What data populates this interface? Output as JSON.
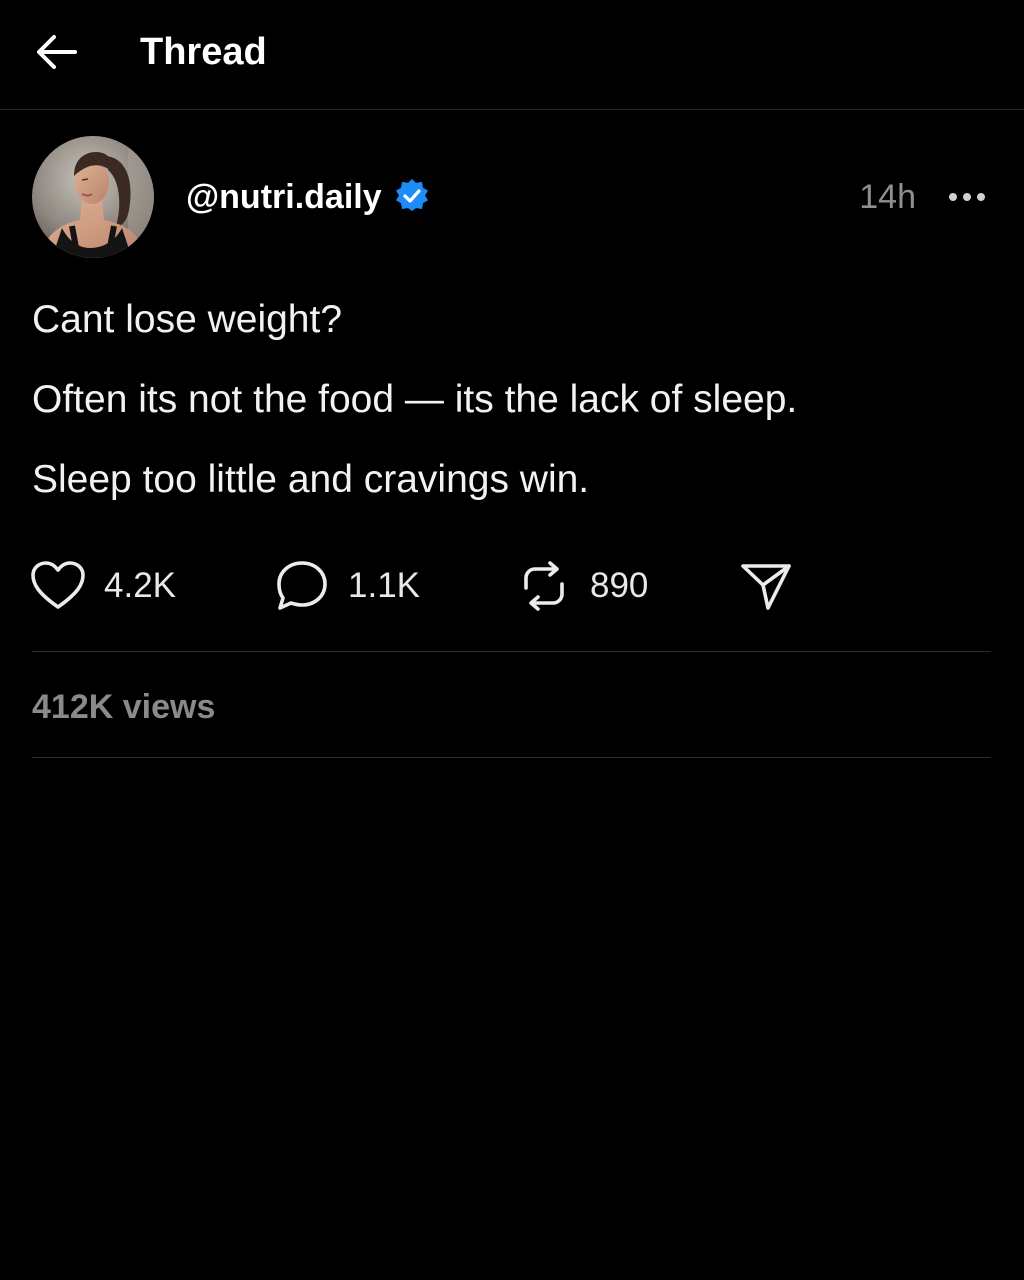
{
  "header": {
    "title": "Thread"
  },
  "post": {
    "handle": "@nutri.daily",
    "verified": true,
    "timestamp": "14h",
    "lines": [
      "Cant lose weight?",
      "Often its not the food — its the lack of sleep.",
      "Sleep too little and cravings win."
    ],
    "actions": {
      "likes": "4.2K",
      "replies": "1.1K",
      "reposts": "890"
    },
    "views": "412K views"
  },
  "colors": {
    "background": "#000000",
    "text": "#f2f2f2",
    "muted": "#8f8f8f",
    "verified_badge": "#1d8cf8",
    "divider": "#2e2e2e"
  },
  "icons": {
    "back": "arrow-left-icon",
    "verified": "verified-badge-icon",
    "more": "more-horizontal-icon",
    "like": "heart-icon",
    "reply": "speech-bubble-icon",
    "repost": "repost-icon",
    "share": "send-icon"
  }
}
